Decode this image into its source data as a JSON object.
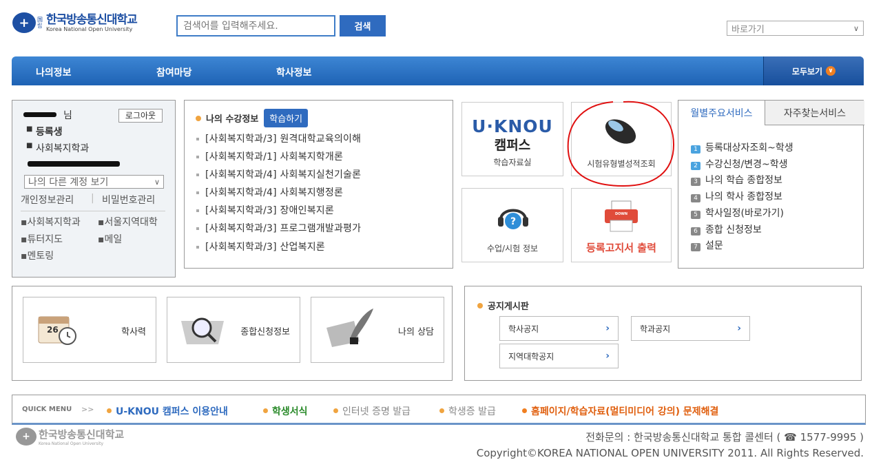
{
  "header": {
    "logo_mark": "国\n립",
    "logo_main": "한국방송통신대학교",
    "logo_sub": "Korea National Open University",
    "search_placeholder": "검색어를 입력해주세요.",
    "search_button": "검색",
    "goto_select": "바로가기"
  },
  "nav": {
    "items": [
      "나의정보",
      "참여마당",
      "학사정보"
    ],
    "all_view": "모두보기"
  },
  "user_panel": {
    "suffix": "님",
    "logout": "로그아웃",
    "status": "등록생",
    "department": "사회복지학과",
    "other_account": "나의 다른 계정 보기",
    "links": [
      "개인정보관리",
      "비밀번호관리"
    ],
    "divider": "|",
    "quick_links": [
      "사회복지학과",
      "서울지역대학",
      "튜터지도",
      "메일",
      "멘토링"
    ]
  },
  "course_info": {
    "title": "나의 수강정보",
    "study_button": "학습하기",
    "courses": [
      "[사회복지학과/3] 원격대학교육의이해",
      "[사회복지학과/1] 사회복지학개론",
      "[사회복지학과/4] 사회복지실천기술론",
      "[사회복지학과/4] 사회복지행정론",
      "[사회복지학과/3] 장애인복지론",
      "[사회복지학과/3] 프로그램개발과평가",
      "[사회복지학과/3] 산업복지론"
    ]
  },
  "tiles": {
    "uknou_logo": "U·KNOU",
    "uknou_campus": "캠퍼스",
    "uknou_label": "학습자료실",
    "exam_label": "시험유형별성적조회",
    "class_label": "수업/시험 정보",
    "print_label": "등록고지서 출력",
    "print_icon_text": "DOWN"
  },
  "monthly": {
    "tab1": "월별주요서비스",
    "tab2": "자주찾는서비스",
    "services": [
      {
        "num": "1",
        "label": "등록대상자조회~학생",
        "color": "#4aa3df"
      },
      {
        "num": "2",
        "label": "수강신청/변경~학생",
        "color": "#4aa3df"
      },
      {
        "num": "3",
        "label": "나의 학습 종합정보",
        "color": "#888888"
      },
      {
        "num": "4",
        "label": "나의 학사 종합정보",
        "color": "#888888"
      },
      {
        "num": "5",
        "label": "학사일정(바로가기)",
        "color": "#888888"
      },
      {
        "num": "6",
        "label": "종합 신청정보",
        "color": "#888888"
      },
      {
        "num": "7",
        "label": "설문",
        "color": "#888888"
      }
    ]
  },
  "quick_tiles": [
    "학사력",
    "종합신청정보",
    "나의 상담"
  ],
  "calendar_day": "26",
  "notice": {
    "title": "공지게시판",
    "buttons": [
      "학사공지",
      "학과공지",
      "지역대학공지"
    ]
  },
  "quick_menu": {
    "label": "QUICK MENU",
    "arrows": ">>",
    "items": [
      {
        "label": "U-KNOU 캠퍼스 이용안내",
        "color": "#2f6bbf",
        "dot": "#f0a440",
        "bold": true
      },
      {
        "label": "학생서식",
        "color": "#2a8a2a",
        "dot": "#f0a440",
        "bold": true
      },
      {
        "label": "인터넷 증명 발급",
        "color": "#888888",
        "dot": "#f0a440",
        "bold": false
      },
      {
        "label": "학생증 발급",
        "color": "#888888",
        "dot": "#f0a440",
        "bold": false
      },
      {
        "label": "홈페이지/학습자료(멀티미디어 강의) 문제해결",
        "color": "#e06010",
        "dot": "#f07f21",
        "bold": true
      }
    ]
  },
  "footer": {
    "logo_main": "한국방송통신대학교",
    "logo_sub": "Korea National Open University",
    "phone": "전화문의 : 한국방송통신대학교 통합 콜센터 ( ☎ 1577-9995 )",
    "copyright": "Copyright©KOREA NATIONAL OPEN UNIVERSITY 2011. All Rights Reserved."
  },
  "colors": {
    "accent": "#2f6bbf",
    "nav": "#1e62b4",
    "highlight": "#e01010"
  }
}
